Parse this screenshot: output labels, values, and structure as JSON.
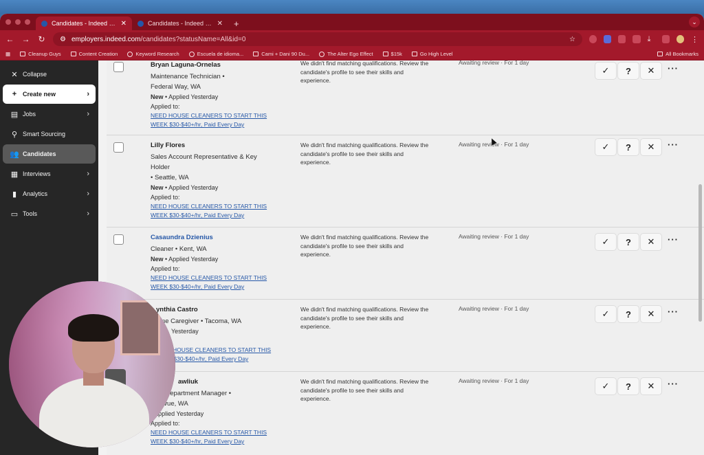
{
  "browser": {
    "tabs": [
      {
        "label": "Candidates - Indeed for Empl",
        "active": true
      },
      {
        "label": "Candidates - Indeed for Emp",
        "active": false
      }
    ],
    "url_host": "employers.indeed.com",
    "url_path": "/candidates?statusName=All&id=0",
    "bookmarks": [
      "Cleanup Guys",
      "Content Creation",
      "Keyword Research",
      "Escuela de idioma...",
      "Cami + Dani 90 Du...",
      "The Alter Ego Effect",
      "$15k",
      "Go High Level"
    ],
    "all_bookmarks": "All Bookmarks",
    "accent": "#a3192b"
  },
  "sidebar": {
    "collapse": "Collapse",
    "items": [
      {
        "label": "Create new",
        "icon": "plus-icon"
      },
      {
        "label": "Jobs",
        "icon": "briefcase-icon"
      },
      {
        "label": "Smart Sourcing",
        "icon": "person-search-icon"
      },
      {
        "label": "Candidates",
        "icon": "people-icon"
      },
      {
        "label": "Interviews",
        "icon": "calendar-icon"
      },
      {
        "label": "Analytics",
        "icon": "bar-chart-icon"
      },
      {
        "label": "Tools",
        "icon": "folder-icon"
      }
    ]
  },
  "candidates": {
    "applied_label": "Applied to:",
    "job_line1": "NEED HOUSE CLEANERS TO START THIS",
    "job_line2": "WEEK $30-$40+/hr, Paid Every Day",
    "quals": "We didn't find matching qualifications. Review the candidate's profile to see their skills and experience.",
    "review": "Awaiting review · For 1 day",
    "rows": [
      {
        "name": "Bryan Laguna-Ornelas",
        "title_l1": "Maintenance Technician •",
        "title_l2": "Federal Way, WA",
        "status_new": "New",
        "status_rest": " • Applied Yesterday"
      },
      {
        "name": "Lilly Flores",
        "title_l1": "Sales Account Representative & Key",
        "title_l2": "Holder",
        "title_l3": " • Seattle, WA",
        "status_new": "New",
        "status_rest": " • Applied Yesterday"
      },
      {
        "name": "Casaundra Dzienius",
        "title_l1": "Cleaner • Kent, WA",
        "status_new": "New",
        "status_rest": " • Applied Yesterday"
      },
      {
        "name": "ynthia Castro",
        "title_l1": "ome Caregiver • Tacoma, WA",
        "status_rest": "Yesterday"
      },
      {
        "name": "awliuk",
        "title_l1": "s Department Manager •",
        "title_l2": "evue, WA",
        "status_rest": " • Applied Yesterday"
      }
    ]
  }
}
